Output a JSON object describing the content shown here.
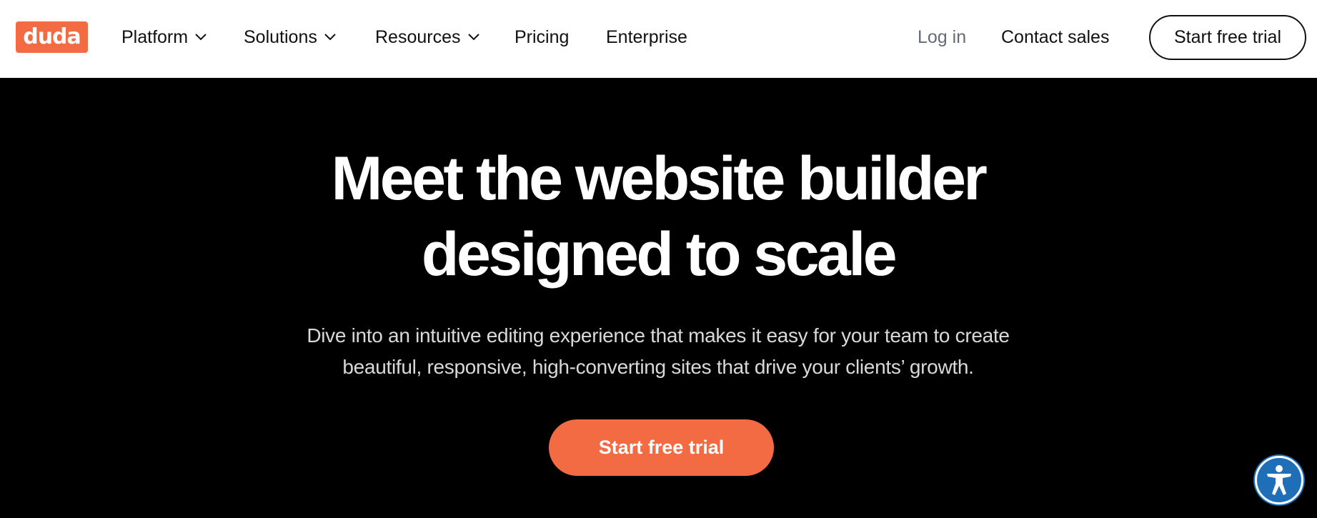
{
  "header": {
    "logo_text": "duda",
    "nav": {
      "platform": "Platform",
      "solutions": "Solutions",
      "resources": "Resources",
      "pricing": "Pricing",
      "enterprise": "Enterprise"
    },
    "login": "Log in",
    "contact_sales": "Contact sales",
    "start_trial": "Start free trial"
  },
  "hero": {
    "title_line1": "Meet the website builder",
    "title_line2": "designed to scale",
    "subtitle_line1": "Dive into an intuitive editing experience that makes it easy for your team to create",
    "subtitle_line2": "beautiful, responsive, high-converting sites that drive your clients’ growth.",
    "cta": "Start free trial"
  },
  "accessibility_widget": {
    "icon": "accessibility-icon"
  },
  "colors": {
    "brand_orange": "#f26b43",
    "hero_background": "#000000",
    "accessibility_blue": "#1e6fb8"
  }
}
